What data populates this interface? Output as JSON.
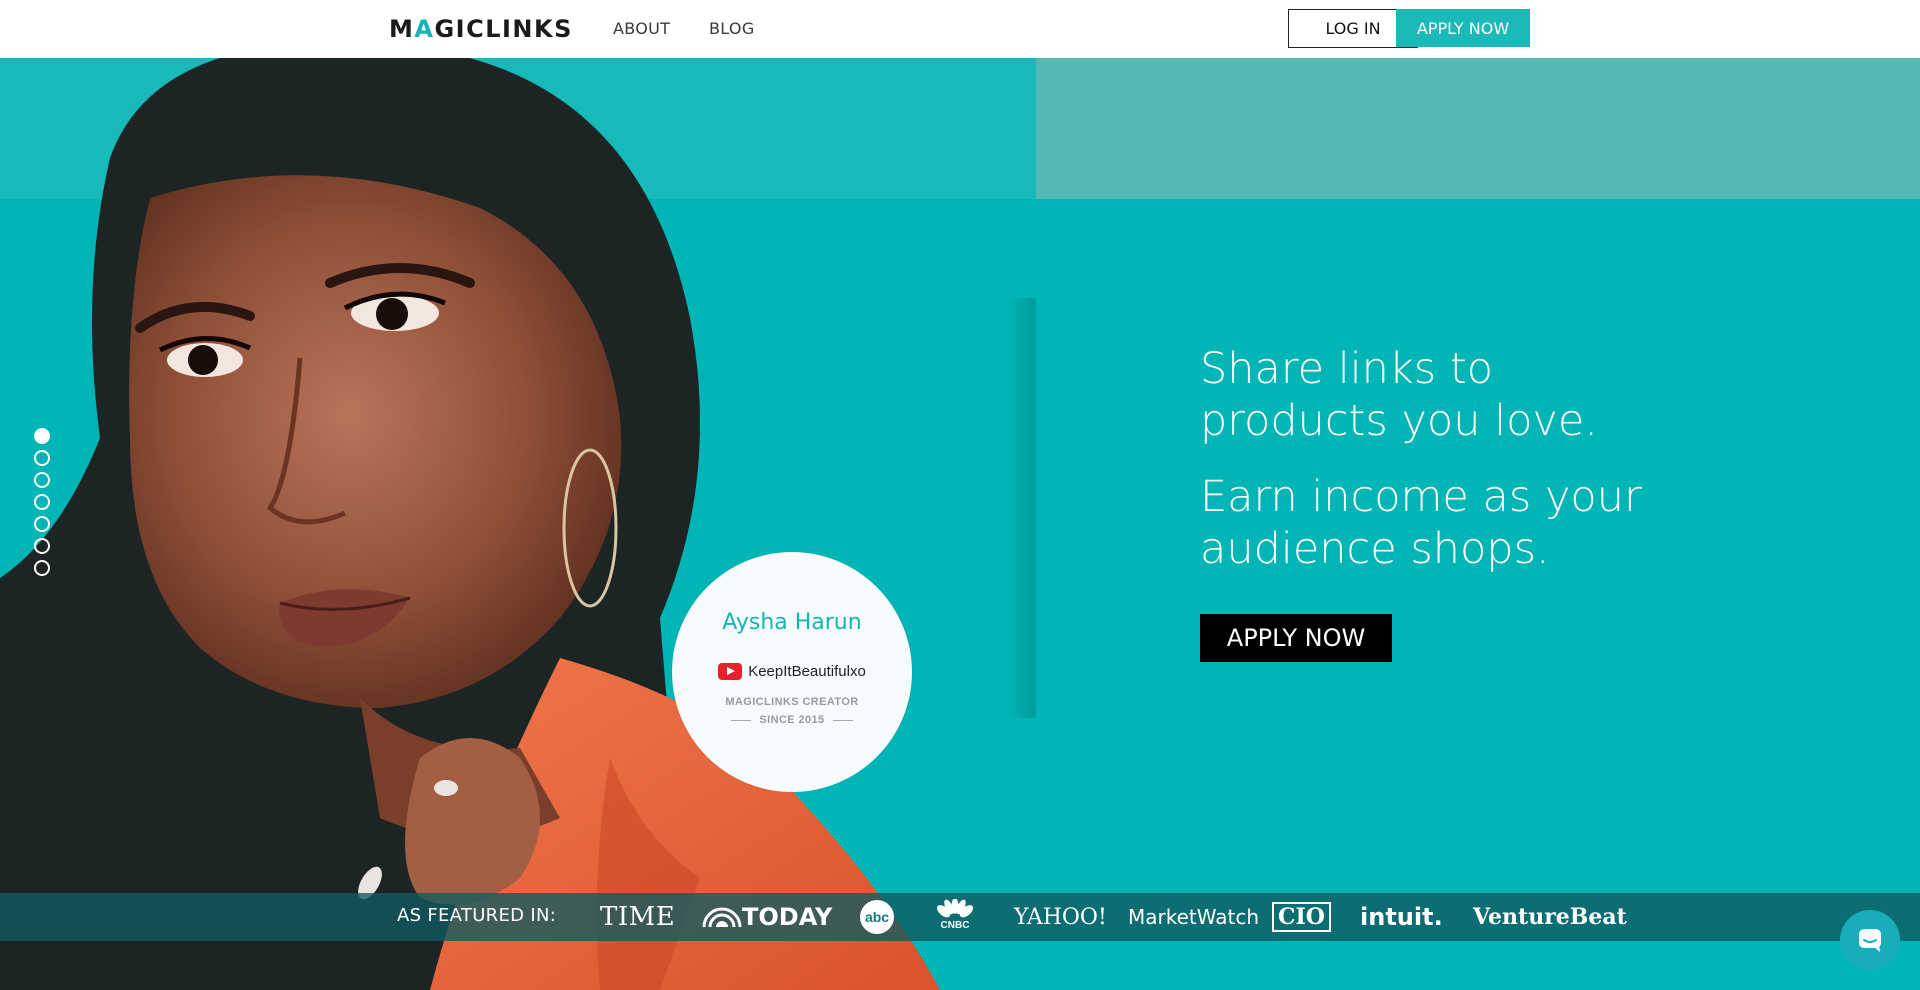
{
  "header": {
    "logo_m": "M",
    "logo_a": "A",
    "logo_rest": "GICLINKS",
    "nav": [
      {
        "label": "ABOUT"
      },
      {
        "label": "BLOG"
      }
    ],
    "login_label": "LOG IN",
    "apply_label": "APPLY NOW"
  },
  "hero": {
    "headline_1": "Share links to products you love.",
    "headline_2": "Earn income as your audience shops.",
    "apply_label": "APPLY NOW",
    "slides_total": 7,
    "active_slide": 1
  },
  "creator_card": {
    "name": "Aysha Harun",
    "channel_icon": "youtube-icon",
    "channel": "KeepItBeautifulxo",
    "role": "MAGICLINKS CREATOR",
    "since": "SINCE 2015"
  },
  "featured": {
    "label": "AS FEATURED IN:",
    "logos": [
      {
        "name": "TIME",
        "text": "TIME"
      },
      {
        "name": "TODAY",
        "text": "TODAY"
      },
      {
        "name": "abc",
        "text": "abc"
      },
      {
        "name": "CNBC",
        "text": "CNBC"
      },
      {
        "name": "YAHOO! FINANCE",
        "text": "YAHOO!"
      },
      {
        "name": "MarketWatch",
        "text": "MarketWatch"
      },
      {
        "name": "CIO",
        "text": "CIO"
      },
      {
        "name": "intuit",
        "text": "intuit."
      },
      {
        "name": "VentureBeat",
        "text": "VentureBeat"
      }
    ]
  },
  "colors": {
    "brand_teal": "#00b5b5",
    "button_teal": "#1cb9b9",
    "black": "#000000"
  },
  "chat": {
    "icon": "chat-icon"
  }
}
